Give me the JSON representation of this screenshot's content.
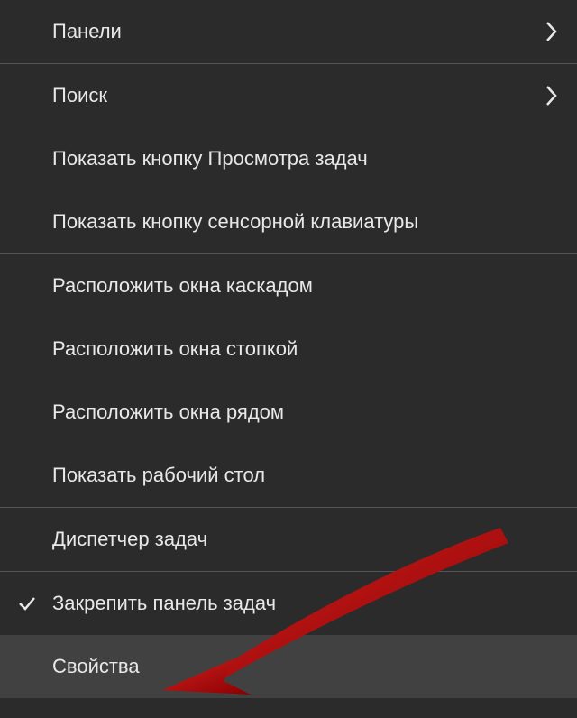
{
  "menu": {
    "groups": [
      {
        "items": [
          {
            "label": "Панели",
            "has_submenu": true,
            "checked": false
          }
        ]
      },
      {
        "items": [
          {
            "label": "Поиск",
            "has_submenu": true,
            "checked": false
          },
          {
            "label": "Показать кнопку Просмотра задач",
            "has_submenu": false,
            "checked": false
          },
          {
            "label": "Показать кнопку сенсорной клавиатуры",
            "has_submenu": false,
            "checked": false
          }
        ]
      },
      {
        "items": [
          {
            "label": "Расположить окна каскадом",
            "has_submenu": false,
            "checked": false
          },
          {
            "label": "Расположить окна стопкой",
            "has_submenu": false,
            "checked": false
          },
          {
            "label": "Расположить окна рядом",
            "has_submenu": false,
            "checked": false
          },
          {
            "label": "Показать рабочий стол",
            "has_submenu": false,
            "checked": false
          }
        ]
      },
      {
        "items": [
          {
            "label": "Диспетчер задач",
            "has_submenu": false,
            "checked": false
          }
        ]
      },
      {
        "items": [
          {
            "label": "Закрепить панель задач",
            "has_submenu": false,
            "checked": true
          },
          {
            "label": "Свойства",
            "has_submenu": false,
            "checked": false,
            "highlighted": true
          }
        ]
      }
    ]
  },
  "annotation": {
    "type": "red-arrow",
    "target_item": "Свойства"
  }
}
